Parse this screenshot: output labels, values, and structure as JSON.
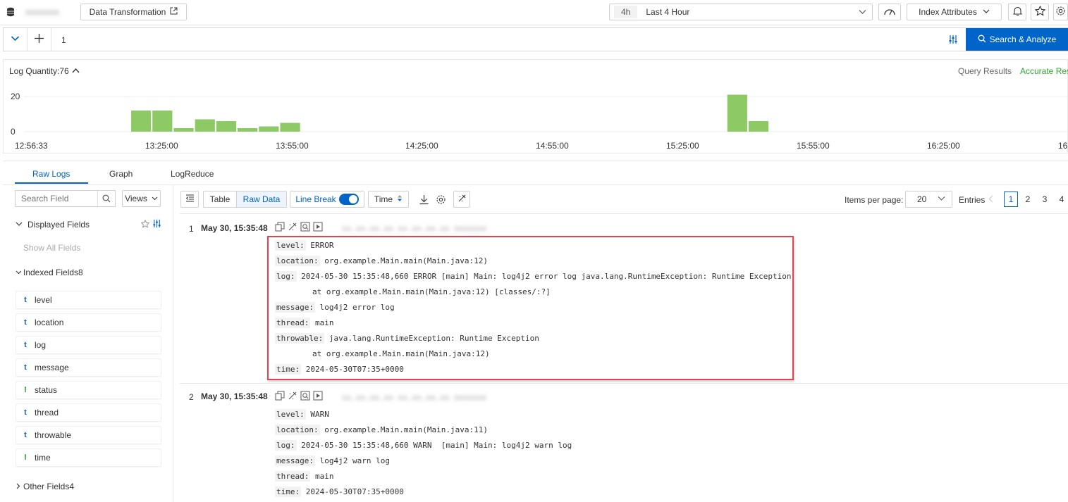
{
  "topbar": {
    "project_name": "xxxxxxxx",
    "data_transformation_label": "Data Transformation",
    "time_range_short": "4h",
    "time_range_label": "Last 4 Hour",
    "index_attributes_label": "Index Attributes"
  },
  "query": {
    "line_number": "1",
    "search_button_label": "Search & Analyze"
  },
  "histogram": {
    "log_quantity_label": "Log Quantity:76",
    "query_results_label": "Query Results",
    "accurate_results_label": "Accurate Res",
    "bar_color": "#8dc965",
    "chart_data": {
      "type": "bar",
      "y_ticks": [
        "20",
        "0"
      ],
      "ylim": [
        0,
        20
      ],
      "x_tick_labels": [
        "12:56:33",
        "13:25:00",
        "13:55:00",
        "14:25:00",
        "14:55:00",
        "15:25:00",
        "15:55:00",
        "16:25:00",
        "16:"
      ],
      "values": [
        0,
        0,
        0,
        0,
        0,
        12,
        12,
        2,
        7,
        6,
        2,
        3,
        5,
        0,
        0,
        0,
        0,
        0,
        0,
        0,
        0,
        0,
        0,
        0,
        0,
        0,
        0,
        0,
        0,
        0,
        0,
        0,
        0,
        21,
        6,
        0,
        0,
        0,
        0,
        0,
        0,
        0,
        0,
        0,
        0,
        0,
        0,
        0,
        0
      ]
    }
  },
  "tabs": [
    "Raw Logs",
    "Graph",
    "LogReduce"
  ],
  "sidebar": {
    "search_placeholder": "Search Field",
    "views_label": "Views",
    "displayed_fields_label": "Displayed Fields",
    "show_all_fields_label": "Show All Fields",
    "indexed_fields_label": "Indexed Fields8",
    "other_fields_label": "Other Fields4",
    "fields": [
      {
        "type": "t",
        "name": "level"
      },
      {
        "type": "t",
        "name": "location"
      },
      {
        "type": "t",
        "name": "log"
      },
      {
        "type": "t",
        "name": "message"
      },
      {
        "type": "l",
        "name": "status"
      },
      {
        "type": "t",
        "name": "thread"
      },
      {
        "type": "t",
        "name": "throwable"
      },
      {
        "type": "l",
        "name": "time"
      }
    ]
  },
  "toolbar": {
    "table_label": "Table",
    "raw_data_label": "Raw Data",
    "line_break_label": "Line Break",
    "time_sort_label": "Time",
    "items_per_page_label": "Items per page:",
    "items_per_page_value": "20",
    "entries_label": "Entries",
    "pages": [
      "1",
      "2",
      "3",
      "4"
    ]
  },
  "logs": [
    {
      "index": "1",
      "timestamp": "May 30, 15:35:48",
      "source_blurred": "xx.xx.xx.xx  xx.xx.xx.xx  xxxxxxx",
      "lines": [
        {
          "key": "level:",
          "value": " ERROR"
        },
        {
          "key": "location:",
          "value": " org.example.Main.main(Main.java:12)"
        },
        {
          "key": "log:",
          "value": " 2024-05-30 15:35:48,660 ERROR [main] Main: log4j2 error log java.lang.RuntimeException: Runtime Exception"
        },
        {
          "key": "",
          "value": "        at org.example.Main.main(Main.java:12) [classes/:?]"
        },
        {
          "key": "message:",
          "value": " log4j2 error log"
        },
        {
          "key": "thread:",
          "value": " main"
        },
        {
          "key": "throwable:",
          "value": " java.lang.RuntimeException: Runtime Exception"
        },
        {
          "key": "",
          "value": "        at org.example.Main.main(Main.java:12)"
        },
        {
          "key": "time:",
          "value": " 2024-05-30T07:35+0000"
        }
      ]
    },
    {
      "index": "2",
      "timestamp": "May 30, 15:35:48",
      "source_blurred": "xx.xx.xx.xx  xx.xx.xx.xx  xxxxxxx",
      "lines": [
        {
          "key": "level:",
          "value": " WARN"
        },
        {
          "key": "location:",
          "value": " org.example.Main.main(Main.java:11)"
        },
        {
          "key": "log:",
          "value": " 2024-05-30 15:35:48,660 WARN  [main] Main: log4j2 warn log"
        },
        {
          "key": "message:",
          "value": " log4j2 warn log"
        },
        {
          "key": "thread:",
          "value": " main"
        },
        {
          "key": "time:",
          "value": " 2024-05-30T07:35+0000"
        }
      ]
    }
  ],
  "highlight_color": "#e0454d",
  "accent_color": "#0064c8"
}
